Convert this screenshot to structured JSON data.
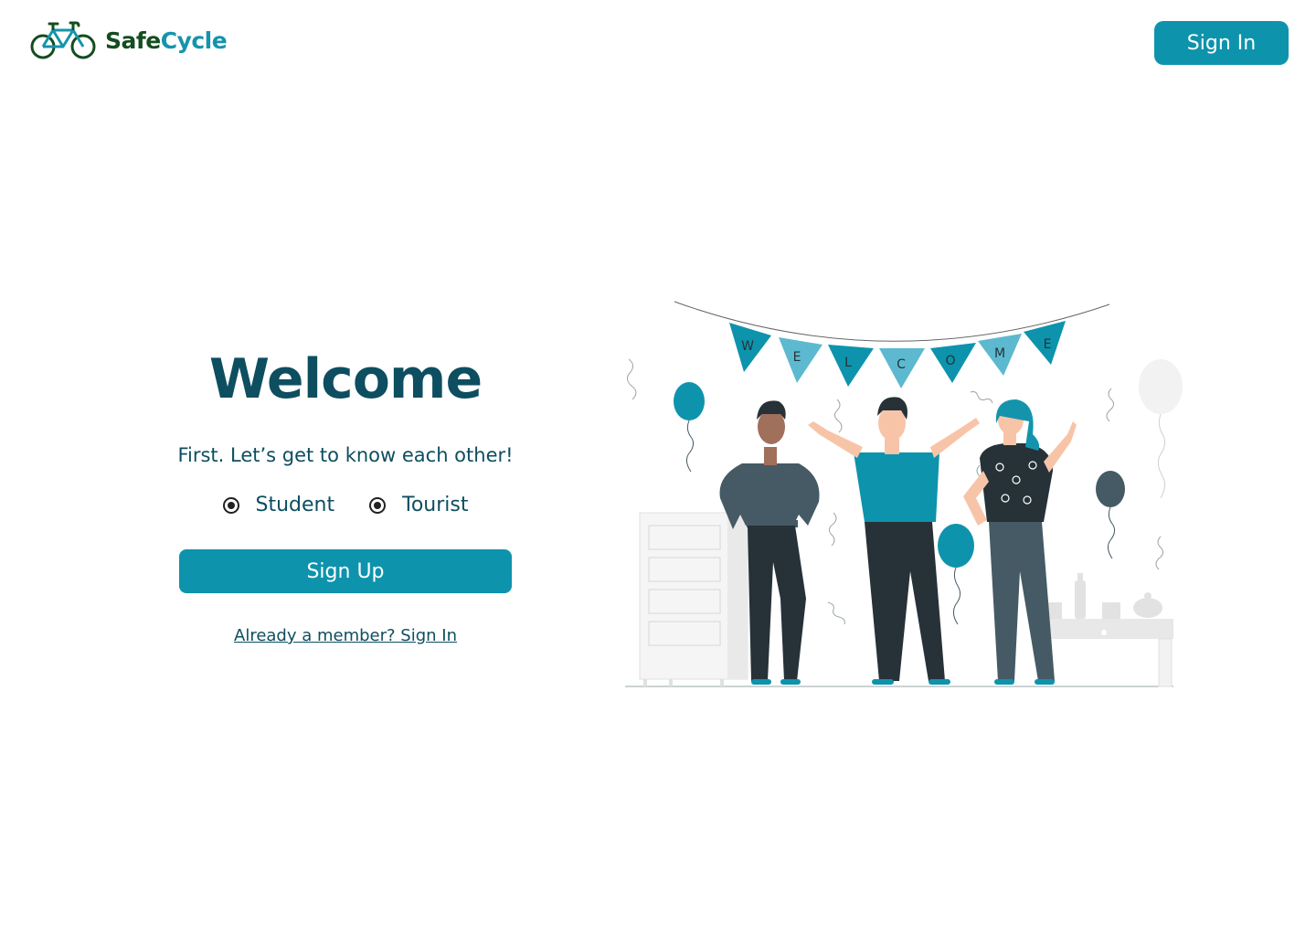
{
  "header": {
    "logo_part1": "SafeCycle",
    "logo_part2": "",
    "sign_in_label": "Sign In"
  },
  "hero": {
    "title": "Welcome",
    "subtitle": "First. Let’s get to know each other!",
    "roles": [
      {
        "label": "Student",
        "selected": true
      },
      {
        "label": "Tourist",
        "selected": true
      }
    ],
    "sign_up_label": "Sign Up",
    "member_link": "Already a member? Sign In"
  },
  "illustration": {
    "banner_letters": [
      "W",
      "E",
      "L",
      "C",
      "O",
      "M",
      "E"
    ],
    "icon": "welcome-party-illustration"
  },
  "colors": {
    "accent": "#0e93ac",
    "heading": "#0d4e60",
    "logo_green": "#144d1f",
    "logo_teal": "#1494ac",
    "slate": "#455a64",
    "dark": "#263238"
  }
}
